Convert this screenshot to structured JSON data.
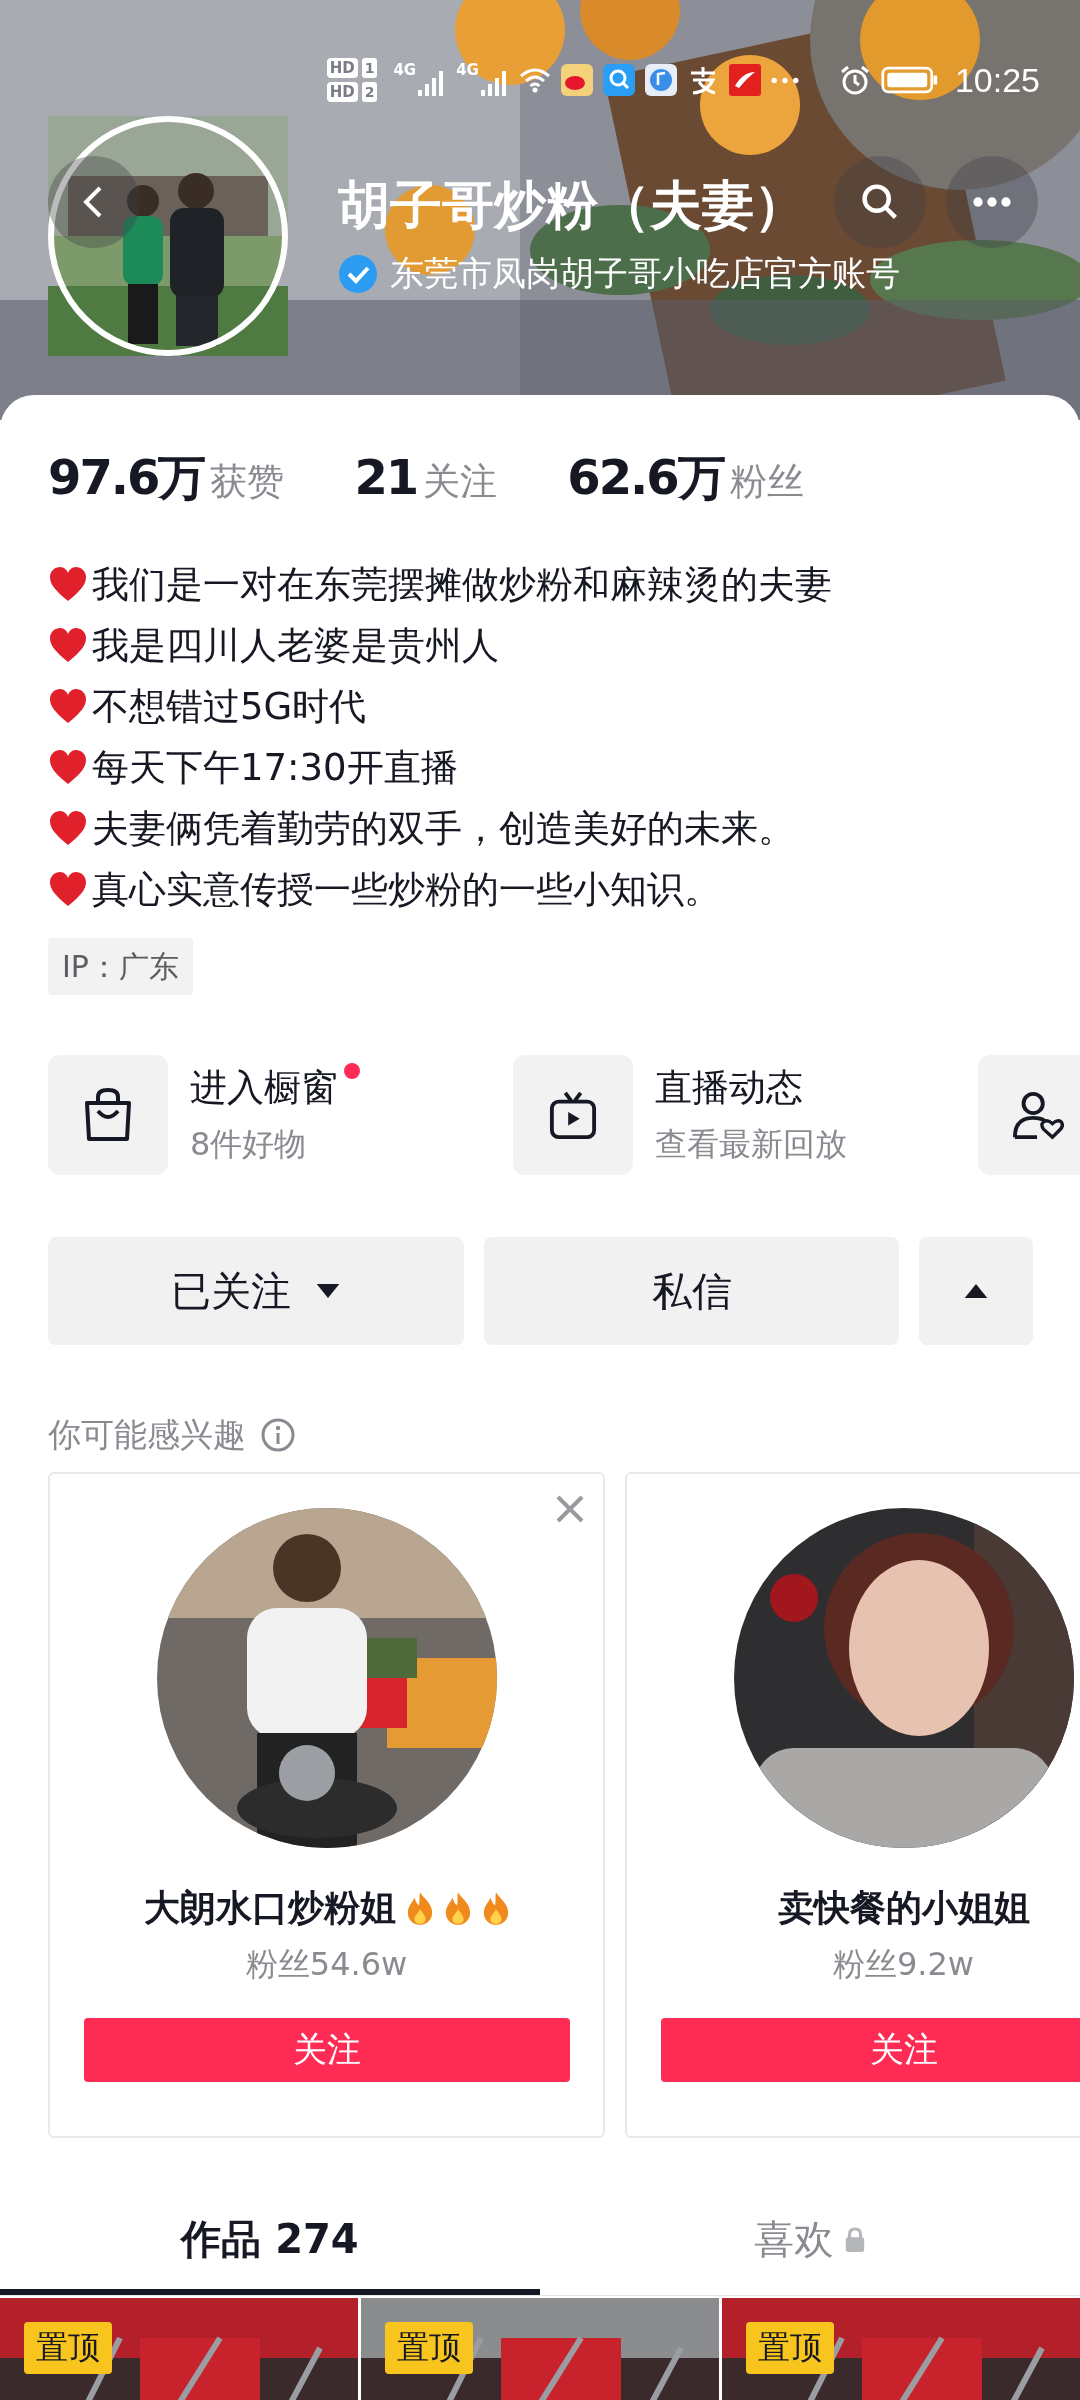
{
  "status_bar": {
    "sims": [
      {
        "label": "HD",
        "slot": "1"
      },
      {
        "label": "HD",
        "slot": "2"
      }
    ],
    "networks": [
      "4G",
      "4G"
    ],
    "time": "10:25"
  },
  "profile": {
    "name": "胡子哥炒粉（夫妻）",
    "verified": true,
    "verified_label": "东莞市凤岗胡子哥小吃店官方账号"
  },
  "stats": [
    {
      "value": "97.6万",
      "label": "获赞"
    },
    {
      "value": "21",
      "label": "关注"
    },
    {
      "value": "62.6万",
      "label": "粉丝"
    }
  ],
  "bio": [
    "我们是一对在东莞摆摊做炒粉和麻辣烫的夫妻",
    "我是四川人老婆是贵州人",
    "不想错过5G时代",
    "每天下午17:30开直播",
    "夫妻俩凭着勤劳的双手，创造美好的未来。",
    "真心实意传授一些炒粉的一些小知识。"
  ],
  "ip": "IP：广东",
  "shortcuts": [
    {
      "kind": "bag",
      "title": "进入橱窗",
      "subtitle": "8件好物",
      "dot": true
    },
    {
      "kind": "tv",
      "title": "直播动态",
      "subtitle": "查看最新回放",
      "dot": false
    },
    {
      "kind": "person-heart"
    }
  ],
  "actions": [
    {
      "kind": "followed",
      "label": "已关注"
    },
    {
      "kind": "message",
      "label": "私信"
    },
    {
      "kind": "collapse"
    }
  ],
  "suggestions": {
    "title": "你可能感兴趣",
    "cards": [
      {
        "name": "大朗水口炒粉姐",
        "flames": [
          {
            "kind": "fire"
          },
          {
            "kind": "fire"
          },
          {
            "kind": "fire"
          }
        ],
        "fans": "粉丝54.6w",
        "button": "关注",
        "closable": true
      },
      {
        "name": "卖快餐的小姐姐",
        "fans": "粉丝9.2w",
        "button": "关注",
        "closable": false
      }
    ]
  },
  "tabs": [
    {
      "label": "作品 274",
      "selected": true,
      "locked": false
    },
    {
      "label": "喜欢",
      "selected": false,
      "locked": true
    }
  ],
  "videos": [
    {
      "badge": "置顶"
    },
    {
      "badge": "置顶"
    },
    {
      "badge": "置顶"
    }
  ]
}
